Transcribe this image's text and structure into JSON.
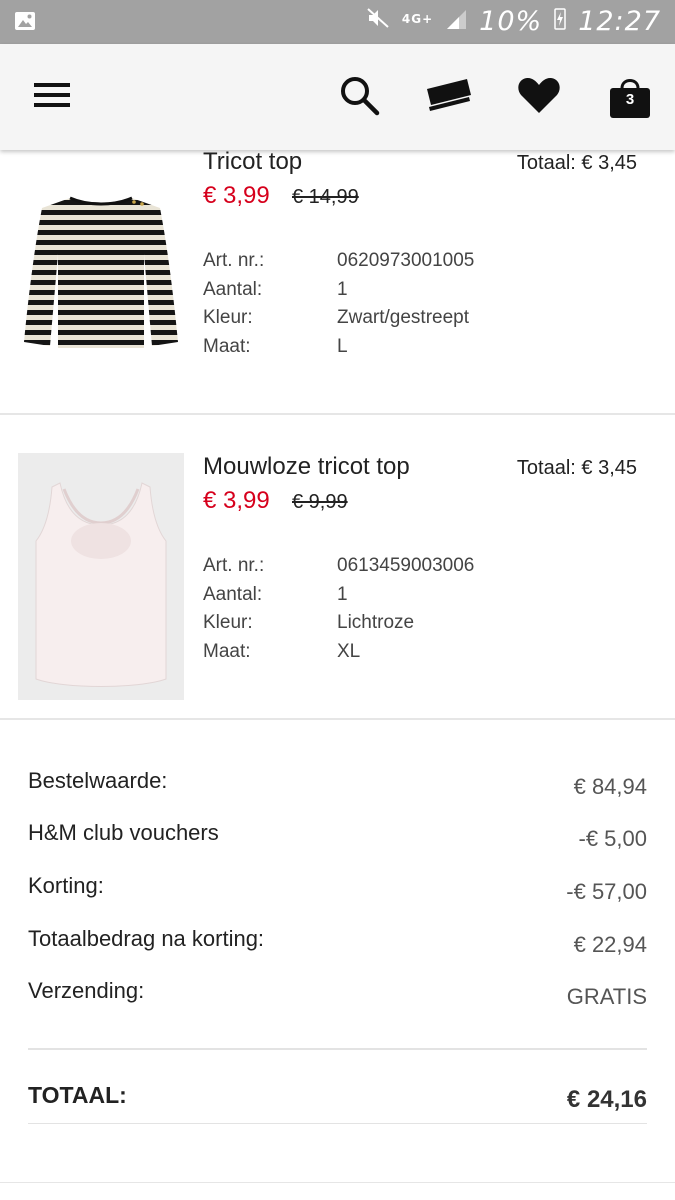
{
  "status_bar": {
    "network": "4G+",
    "battery": "10%",
    "time": "12:27"
  },
  "header": {
    "bag_count": "3"
  },
  "items": [
    {
      "name": "Tricot top",
      "total": "Totaal: € 3,45",
      "price_new": "€ 3,99",
      "price_old": "€ 14,99",
      "details": [
        {
          "label": "Art. nr.:",
          "value": "0620973001005"
        },
        {
          "label": "Aantal:",
          "value": "1"
        },
        {
          "label": "Kleur:",
          "value": "Zwart/gestreept"
        },
        {
          "label": "Maat:",
          "value": "L"
        }
      ]
    },
    {
      "name": "Mouwloze tricot top",
      "total": "Totaal: € 3,45",
      "price_new": "€ 3,99",
      "price_old": "€ 9,99",
      "details": [
        {
          "label": "Art. nr.:",
          "value": "0613459003006"
        },
        {
          "label": "Aantal:",
          "value": "1"
        },
        {
          "label": "Kleur:",
          "value": "Lichtroze"
        },
        {
          "label": "Maat:",
          "value": "XL"
        }
      ]
    }
  ],
  "summary": [
    {
      "label": "Bestelwaarde:",
      "value": "€ 84,94"
    },
    {
      "label": "H&M club vouchers",
      "value": "-€ 5,00"
    },
    {
      "label": "Korting:",
      "value": "-€ 57,00"
    },
    {
      "label": "Totaalbedrag na korting:",
      "value": "€ 22,94"
    },
    {
      "label": "Verzending:",
      "value": "GRATIS"
    }
  ],
  "total": {
    "label": "TOTAAL:",
    "value": "€ 24,16"
  },
  "colors": {
    "sale_red": "#d6001c",
    "status_bar": "#a2a2a2",
    "header_bg": "#f5f5f5"
  }
}
